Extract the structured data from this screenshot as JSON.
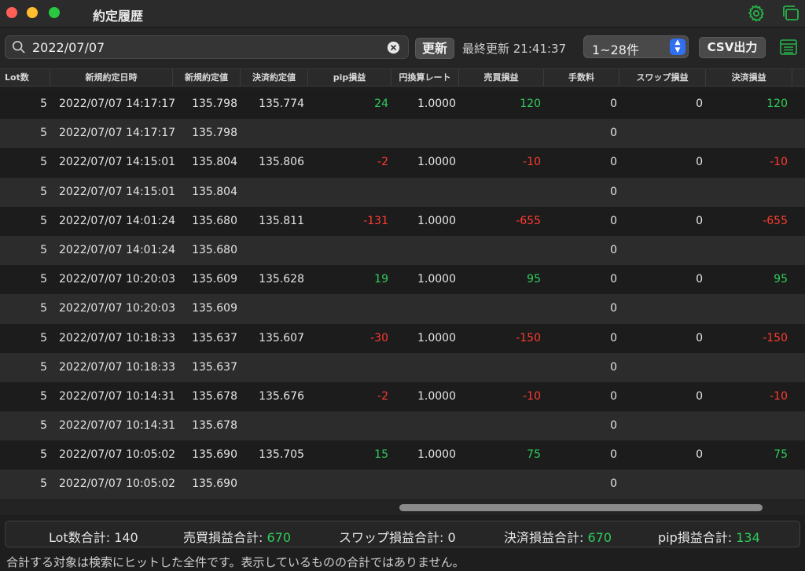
{
  "window": {
    "title": "約定履歴"
  },
  "toolbar": {
    "search_value": "2022/07/07",
    "refresh_label": "更新",
    "last_updated": "最終更新 21:41:37",
    "range_value": "1~28件",
    "csv_label": "CSV出力"
  },
  "columns": [
    "Lot数",
    "新規約定日時",
    "新規約定値",
    "決済約定値",
    "pip損益",
    "円換算レート",
    "売買損益",
    "手数料",
    "スワップ損益",
    "決済損益"
  ],
  "rows": [
    [
      "5",
      "2022/07/07 14:17:17",
      "135.798",
      "135.774",
      "24",
      "1.0000",
      "120",
      "0",
      "0",
      "120"
    ],
    [
      "5",
      "2022/07/07 14:17:17",
      "135.798",
      "",
      "",
      "",
      "",
      "0",
      "",
      ""
    ],
    [
      "5",
      "2022/07/07 14:15:01",
      "135.804",
      "135.806",
      "-2",
      "1.0000",
      "-10",
      "0",
      "0",
      "-10"
    ],
    [
      "5",
      "2022/07/07 14:15:01",
      "135.804",
      "",
      "",
      "",
      "",
      "0",
      "",
      ""
    ],
    [
      "5",
      "2022/07/07 14:01:24",
      "135.680",
      "135.811",
      "-131",
      "1.0000",
      "-655",
      "0",
      "0",
      "-655"
    ],
    [
      "5",
      "2022/07/07 14:01:24",
      "135.680",
      "",
      "",
      "",
      "",
      "0",
      "",
      ""
    ],
    [
      "5",
      "2022/07/07 10:20:03",
      "135.609",
      "135.628",
      "19",
      "1.0000",
      "95",
      "0",
      "0",
      "95"
    ],
    [
      "5",
      "2022/07/07 10:20:03",
      "135.609",
      "",
      "",
      "",
      "",
      "0",
      "",
      ""
    ],
    [
      "5",
      "2022/07/07 10:18:33",
      "135.637",
      "135.607",
      "-30",
      "1.0000",
      "-150",
      "0",
      "0",
      "-150"
    ],
    [
      "5",
      "2022/07/07 10:18:33",
      "135.637",
      "",
      "",
      "",
      "",
      "0",
      "",
      ""
    ],
    [
      "5",
      "2022/07/07 10:14:31",
      "135.678",
      "135.676",
      "-2",
      "1.0000",
      "-10",
      "0",
      "0",
      "-10"
    ],
    [
      "5",
      "2022/07/07 10:14:31",
      "135.678",
      "",
      "",
      "",
      "",
      "0",
      "",
      ""
    ],
    [
      "5",
      "2022/07/07 10:05:02",
      "135.690",
      "135.705",
      "15",
      "1.0000",
      "75",
      "0",
      "0",
      "75"
    ],
    [
      "5",
      "2022/07/07 10:05:02",
      "135.690",
      "",
      "",
      "",
      "",
      "0",
      "",
      ""
    ]
  ],
  "summary": {
    "lot_label": "Lot数合計:",
    "lot_value": "140",
    "trade_pl_label": "売買損益合計:",
    "trade_pl_value": "670",
    "swap_label": "スワップ損益合計:",
    "swap_value": "0",
    "settle_label": "決済損益合計:",
    "settle_value": "670",
    "pip_label": "pip損益合計:",
    "pip_value": "134"
  },
  "note": "合計する対象は検索にヒットした全件です。表示しているものの合計ではありません。",
  "colors": {
    "positive": "#2ecc5a",
    "negative": "#ff3b30",
    "accent": "#27b34a"
  }
}
